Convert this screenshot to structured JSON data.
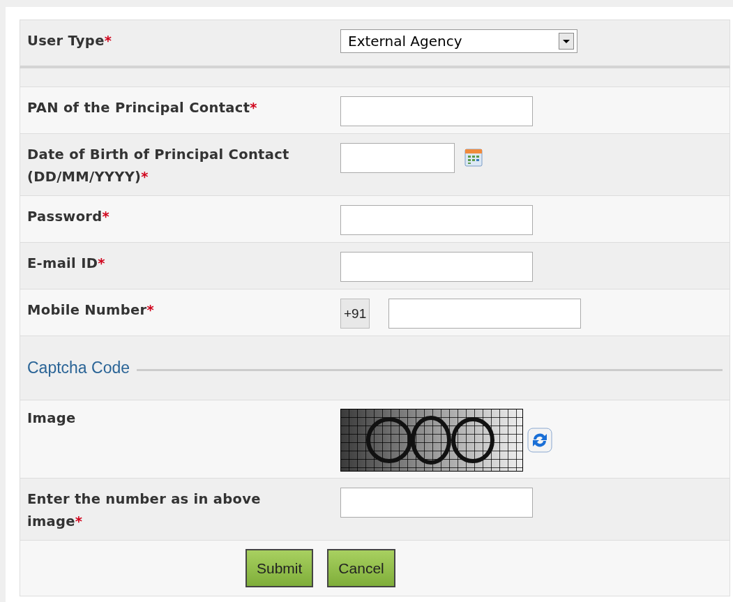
{
  "user_type": {
    "label": "User Type",
    "required": true,
    "value": "External Agency"
  },
  "fields": [
    {
      "kind": "text",
      "label": "PAN of the Principal Contact",
      "required": true
    },
    {
      "kind": "date",
      "label": "Date of Birth of Principal Contact (DD/MM/YYYY)",
      "required": true
    },
    {
      "kind": "text",
      "label": "Password",
      "required": true
    },
    {
      "kind": "text",
      "label": "E-mail ID",
      "required": true
    },
    {
      "kind": "phone",
      "label": "Mobile Number",
      "required": true,
      "prefix": "+91"
    },
    {
      "kind": "section",
      "label": "Captcha Code"
    },
    {
      "kind": "captcha",
      "label": "Image",
      "required": false
    },
    {
      "kind": "text",
      "label": "Enter the number as in above image",
      "required": true
    }
  ],
  "required_mark": "*",
  "buttons": [
    "Submit",
    "Cancel"
  ]
}
